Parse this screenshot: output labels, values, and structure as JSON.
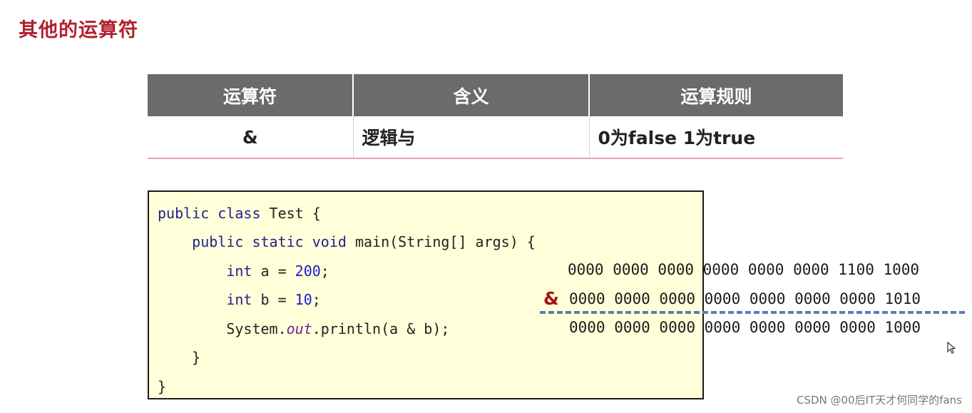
{
  "title": "其他的运算符",
  "table": {
    "headers": [
      "运算符",
      "含义",
      "运算规则"
    ],
    "rows": [
      [
        "&",
        "逻辑与",
        "0为false 1为true"
      ]
    ]
  },
  "code": {
    "lines": [
      "public class Test {",
      "    public static void main(String[] args) {",
      "        int a = 200;",
      "        int b = 10;",
      "        System.out.println(a & b);",
      "    }",
      "}"
    ]
  },
  "binary": {
    "a": "0000 0000 0000 0000 0000 0000 1100 1000",
    "operator": "&",
    "b": "0000 0000 0000 0000 0000 0000 0000 1010",
    "result": "0000 0000 0000 0000 0000 0000 0000 1000"
  },
  "watermark": "CSDN @00后IT天才何同学的fans",
  "colors": {
    "title": "#b21f2d",
    "header_bg": "#6b6b6b",
    "row_border": "#e8a0b4",
    "code_bg": "#ffffd9",
    "operator": "#a61414",
    "dash_line": "#5b7fb5"
  }
}
